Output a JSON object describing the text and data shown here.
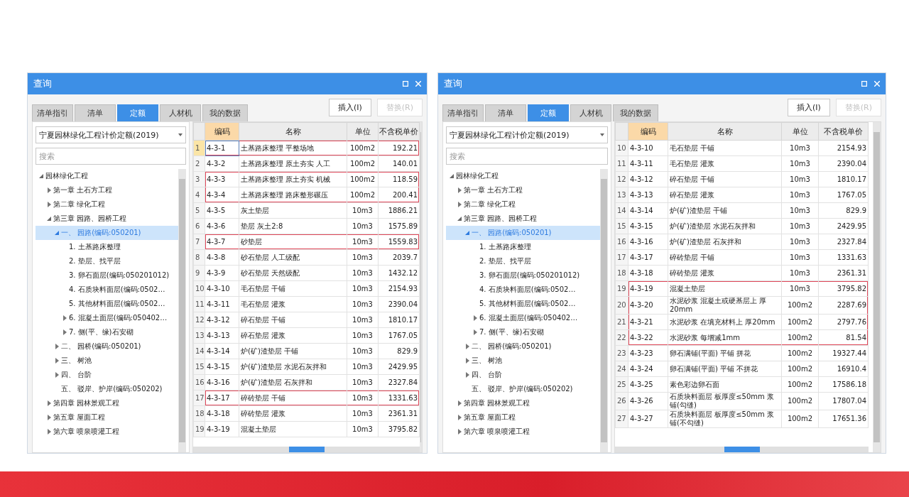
{
  "panels": [
    {
      "title": "查询",
      "tabs": [
        {
          "label": "清单指引",
          "selected": false
        },
        {
          "label": "清单",
          "selected": false
        },
        {
          "label": "定额",
          "selected": true
        },
        {
          "label": "人材机",
          "selected": false
        },
        {
          "label": "我的数据",
          "selected": false
        }
      ],
      "buttons": [
        {
          "label": "插入(I)",
          "disabled": false
        },
        {
          "label": "替换(R)",
          "disabled": true
        }
      ],
      "library": "宁夏园林绿化工程计价定额(2019)",
      "search": {
        "placeholder": "搜索"
      },
      "tree": [
        {
          "label": "园林绿化工程",
          "expanded": true,
          "selected": false,
          "children": [
            {
              "label": "第一章 土石方工程",
              "expanded": false,
              "selected": false
            },
            {
              "label": "第二章 绿化工程",
              "expanded": false,
              "selected": false
            },
            {
              "label": "第三章 园路、园桥工程",
              "expanded": true,
              "selected": false,
              "children": [
                {
                  "label": "一、 园路(编码:050201)",
                  "expanded": true,
                  "selected": true,
                  "children": [
                    {
                      "label": "1. 土基路床整理",
                      "selected": false
                    },
                    {
                      "label": "2. 垫层、找平层",
                      "selected": false
                    },
                    {
                      "label": "3. 卵石面层(编码:050201012)",
                      "selected": false
                    },
                    {
                      "label": "4. 石质块料面层(编码:0502…",
                      "selected": false
                    },
                    {
                      "label": "5. 其他材料面层(编码:0502…",
                      "selected": false
                    },
                    {
                      "label": "6. 混凝土面层(编码:050402…",
                      "expanded": false,
                      "selected": false
                    },
                    {
                      "label": "7. 侧(平、缘)石安砌",
                      "expanded": false,
                      "selected": false
                    }
                  ]
                },
                {
                  "label": "二、 园桥(编码:050201)",
                  "expanded": false,
                  "selected": false
                },
                {
                  "label": "三、 树池",
                  "expanded": false,
                  "selected": false
                },
                {
                  "label": "四、 台阶",
                  "expanded": false,
                  "selected": false
                },
                {
                  "label": "五、 驳岸、护岸(编码:050202)",
                  "selected": false
                }
              ]
            },
            {
              "label": "第四章 园林景观工程",
              "expanded": false,
              "selected": false
            },
            {
              "label": "第五章 屋面工程",
              "expanded": false,
              "selected": false
            },
            {
              "label": "第六章 喷泉喷灌工程",
              "expanded": false,
              "selected": false
            }
          ]
        }
      ],
      "table": {
        "columns": [
          "编码",
          "名称",
          "单位",
          "不含税单价"
        ],
        "rows": [
          {
            "index": "1",
            "code": "4-3-1",
            "name": "土基路床整理 平整场地",
            "unit": "100m2",
            "price": "192.21",
            "marked": true,
            "selected": true
          },
          {
            "index": "2",
            "code": "4-3-2",
            "name": "土基路床整理 原土夯实 人工",
            "unit": "100m2",
            "price": "140.01",
            "marked": false,
            "selected": false
          },
          {
            "index": "3",
            "code": "4-3-3",
            "name": "土基路床整理 原土夯实 机械",
            "unit": "100m2",
            "price": "118.59",
            "marked": true,
            "selected": false
          },
          {
            "index": "4",
            "code": "4-3-4",
            "name": "土基路床整理 路床整形碾压",
            "unit": "100m2",
            "price": "200.41",
            "marked": true,
            "selected": false
          },
          {
            "index": "5",
            "code": "4-3-5",
            "name": "灰土垫层",
            "unit": "10m3",
            "price": "1886.21",
            "marked": false,
            "selected": false
          },
          {
            "index": "6",
            "code": "4-3-6",
            "name": "垫层 灰土2:8",
            "unit": "10m3",
            "price": "1575.89",
            "marked": false,
            "selected": false
          },
          {
            "index": "7",
            "code": "4-3-7",
            "name": "砂垫层",
            "unit": "10m3",
            "price": "1559.83",
            "marked": true,
            "selected": false
          },
          {
            "index": "8",
            "code": "4-3-8",
            "name": "砂石垫层 人工级配",
            "unit": "10m3",
            "price": "2039.7",
            "marked": false,
            "selected": false
          },
          {
            "index": "9",
            "code": "4-3-9",
            "name": "砂石垫层 天然级配",
            "unit": "10m3",
            "price": "1432.12",
            "marked": false,
            "selected": false
          },
          {
            "index": "10",
            "code": "4-3-10",
            "name": "毛石垫层 干铺",
            "unit": "10m3",
            "price": "2154.93",
            "marked": false,
            "selected": false
          },
          {
            "index": "11",
            "code": "4-3-11",
            "name": "毛石垫层 灌浆",
            "unit": "10m3",
            "price": "2390.04",
            "marked": false,
            "selected": false
          },
          {
            "index": "12",
            "code": "4-3-12",
            "name": "碎石垫层 干铺",
            "unit": "10m3",
            "price": "1810.17",
            "marked": false,
            "selected": false
          },
          {
            "index": "13",
            "code": "4-3-13",
            "name": "碎石垫层 灌浆",
            "unit": "10m3",
            "price": "1767.05",
            "marked": false,
            "selected": false
          },
          {
            "index": "14",
            "code": "4-3-14",
            "name": "炉(矿)渣垫层 干铺",
            "unit": "10m3",
            "price": "829.9",
            "marked": false,
            "selected": false
          },
          {
            "index": "15",
            "code": "4-3-15",
            "name": "炉(矿)渣垫层 水泥石灰拌和",
            "unit": "10m3",
            "price": "2429.95",
            "marked": false,
            "selected": false
          },
          {
            "index": "16",
            "code": "4-3-16",
            "name": "炉(矿)渣垫层 石灰拌和",
            "unit": "10m3",
            "price": "2327.84",
            "marked": false,
            "selected": false
          },
          {
            "index": "17",
            "code": "4-3-17",
            "name": "碎砖垫层 干铺",
            "unit": "10m3",
            "price": "1331.63",
            "marked": true,
            "selected": false
          },
          {
            "index": "18",
            "code": "4-3-18",
            "name": "碎砖垫层 灌浆",
            "unit": "10m3",
            "price": "2361.31",
            "marked": false,
            "selected": false
          },
          {
            "index": "19",
            "code": "4-3-19",
            "name": "混凝土垫层",
            "unit": "10m3",
            "price": "3795.82",
            "marked": false,
            "selected": false
          }
        ]
      }
    },
    {
      "title": "查询",
      "tabs": [
        {
          "label": "清单指引",
          "selected": false
        },
        {
          "label": "清单",
          "selected": false
        },
        {
          "label": "定额",
          "selected": true
        },
        {
          "label": "人材机",
          "selected": false
        },
        {
          "label": "我的数据",
          "selected": false
        }
      ],
      "buttons": [
        {
          "label": "插入(I)",
          "disabled": false
        },
        {
          "label": "替换(R)",
          "disabled": true
        }
      ],
      "library": "宁夏园林绿化工程计价定额(2019)",
      "search": {
        "placeholder": "搜索"
      },
      "tree": [
        {
          "label": "园林绿化工程",
          "expanded": true,
          "selected": false,
          "children": [
            {
              "label": "第一章 土石方工程",
              "expanded": false,
              "selected": false
            },
            {
              "label": "第二章 绿化工程",
              "expanded": false,
              "selected": false
            },
            {
              "label": "第三章 园路、园桥工程",
              "expanded": true,
              "selected": false,
              "children": [
                {
                  "label": "一、 园路(编码:050201)",
                  "expanded": true,
                  "selected": true,
                  "children": [
                    {
                      "label": "1. 土基路床整理",
                      "selected": false
                    },
                    {
                      "label": "2. 垫层、找平层",
                      "selected": false
                    },
                    {
                      "label": "3. 卵石面层(编码:050201012)",
                      "selected": false
                    },
                    {
                      "label": "4. 石质块料面层(编码:0502…",
                      "selected": false
                    },
                    {
                      "label": "5. 其他材料面层(编码:0502…",
                      "selected": false
                    },
                    {
                      "label": "6. 混凝土面层(编码:050402…",
                      "expanded": false,
                      "selected": false
                    },
                    {
                      "label": "7. 侧(平、缘)石安砌",
                      "expanded": false,
                      "selected": false
                    }
                  ]
                },
                {
                  "label": "二、 园桥(编码:050201)",
                  "expanded": false,
                  "selected": false
                },
                {
                  "label": "三、 树池",
                  "expanded": false,
                  "selected": false
                },
                {
                  "label": "四、 台阶",
                  "expanded": false,
                  "selected": false
                },
                {
                  "label": "五、 驳岸、护岸(编码:050202)",
                  "selected": false
                }
              ]
            },
            {
              "label": "第四章 园林景观工程",
              "expanded": false,
              "selected": false
            },
            {
              "label": "第五章 屋面工程",
              "expanded": false,
              "selected": false
            },
            {
              "label": "第六章 喷泉喷灌工程",
              "expanded": false,
              "selected": false
            }
          ]
        }
      ],
      "table": {
        "columns": [
          "编码",
          "名称",
          "单位",
          "不含税单价"
        ],
        "rows": [
          {
            "index": "10",
            "code": "4-3-10",
            "name": "毛石垫层 干铺",
            "unit": "10m3",
            "price": "2154.93",
            "marked": false,
            "selected": false
          },
          {
            "index": "11",
            "code": "4-3-11",
            "name": "毛石垫层 灌浆",
            "unit": "10m3",
            "price": "2390.04",
            "marked": false,
            "selected": false
          },
          {
            "index": "12",
            "code": "4-3-12",
            "name": "碎石垫层 干铺",
            "unit": "10m3",
            "price": "1810.17",
            "marked": false,
            "selected": false
          },
          {
            "index": "13",
            "code": "4-3-13",
            "name": "碎石垫层 灌浆",
            "unit": "10m3",
            "price": "1767.05",
            "marked": false,
            "selected": false
          },
          {
            "index": "14",
            "code": "4-3-14",
            "name": "炉(矿)渣垫层 干铺",
            "unit": "10m3",
            "price": "829.9",
            "marked": false,
            "selected": false
          },
          {
            "index": "15",
            "code": "4-3-15",
            "name": "炉(矿)渣垫层 水泥石灰拌和",
            "unit": "10m3",
            "price": "2429.95",
            "marked": false,
            "selected": false
          },
          {
            "index": "16",
            "code": "4-3-16",
            "name": "炉(矿)渣垫层 石灰拌和",
            "unit": "10m3",
            "price": "2327.84",
            "marked": false,
            "selected": false
          },
          {
            "index": "17",
            "code": "4-3-17",
            "name": "碎砖垫层 干铺",
            "unit": "10m3",
            "price": "1331.63",
            "marked": false,
            "selected": false
          },
          {
            "index": "18",
            "code": "4-3-18",
            "name": "碎砖垫层 灌浆",
            "unit": "10m3",
            "price": "2361.31",
            "marked": false,
            "selected": false
          },
          {
            "index": "19",
            "code": "4-3-19",
            "name": "混凝土垫层",
            "unit": "10m3",
            "price": "3795.82",
            "marked": true,
            "selected": false
          },
          {
            "index": "20",
            "code": "4-3-20",
            "name": "水泥砂浆 混凝土或硬基层上 厚20mm",
            "unit": "100m2",
            "price": "2287.69",
            "marked": true,
            "selected": false
          },
          {
            "index": "21",
            "code": "4-3-21",
            "name": "水泥砂浆 在填充材料上 厚20mm",
            "unit": "100m2",
            "price": "2797.76",
            "marked": true,
            "selected": false
          },
          {
            "index": "22",
            "code": "4-3-22",
            "name": "水泥砂浆 每增减1mm",
            "unit": "100m2",
            "price": "81.54",
            "marked": true,
            "selected": false
          },
          {
            "index": "23",
            "code": "4-3-23",
            "name": "卵石满铺(平面) 平铺 拼花",
            "unit": "100m2",
            "price": "19327.44",
            "marked": false,
            "selected": false
          },
          {
            "index": "24",
            "code": "4-3-24",
            "name": "卵石满铺(平面) 平铺 不拼花",
            "unit": "100m2",
            "price": "16910.4",
            "marked": false,
            "selected": false
          },
          {
            "index": "25",
            "code": "4-3-25",
            "name": "素色彩边卵石面",
            "unit": "100m2",
            "price": "17586.18",
            "marked": false,
            "selected": false
          },
          {
            "index": "26",
            "code": "4-3-26",
            "name": "石质块料面层 板厚度≤50mm 浆铺(勾缝)",
            "unit": "100m2",
            "price": "17807.04",
            "marked": false,
            "selected": false
          },
          {
            "index": "27",
            "code": "4-3-27",
            "name": "石质块料面层 板厚度≤50mm 浆铺(不勾缝)",
            "unit": "100m2",
            "price": "17651.36",
            "marked": false,
            "selected": false
          }
        ]
      }
    }
  ]
}
